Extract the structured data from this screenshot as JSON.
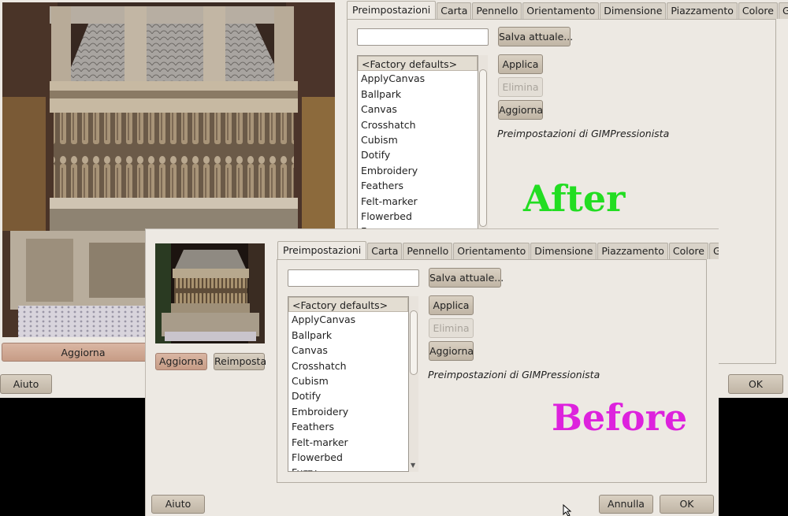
{
  "tabs": [
    "Preimpostazioni",
    "Carta",
    "Pennello",
    "Orientamento",
    "Dimensione",
    "Piazzamento",
    "Colore",
    "Generale"
  ],
  "presets_list": [
    "<Factory defaults>",
    "ApplyCanvas",
    "Ballpark",
    "Canvas",
    "Crosshatch",
    "Cubism",
    "Dotify",
    "Embroidery",
    "Feathers",
    "Felt-marker",
    "Flowerbed",
    "Furry"
  ],
  "save_current_label": "Salva attuale...",
  "apply_label": "Applica",
  "delete_label": "Elimina",
  "refresh_label": "Aggiorna",
  "presets_caption": "Preimpostazioni di GIMPressionista",
  "after": {
    "label": "After",
    "label_color": "#22dd22",
    "preview_update_label": "Aggiorna",
    "help_label": "Aiuto",
    "ok_label": "OK"
  },
  "before": {
    "label": "Before",
    "label_color": "#dd22dd",
    "preview_update_label": "Aggiorna",
    "preview_reset_label": "Reimposta",
    "help_label": "Aiuto",
    "cancel_label": "Annulla",
    "ok_label": "OK"
  }
}
